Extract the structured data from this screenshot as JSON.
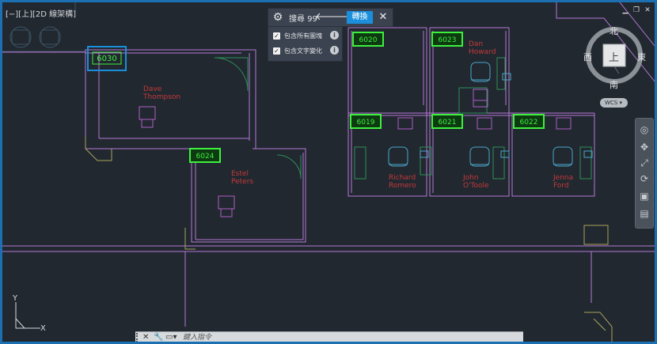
{
  "viewport": {
    "label": "[−][上][2D 線架構]"
  },
  "find_toolbar": {
    "label": "搜尋 99",
    "prev_icon": "arrow-left-icon",
    "next_icon": "arrow-right-icon",
    "replace_label": "轉換",
    "options": [
      {
        "label": "包含所有圖塊",
        "checked": true
      },
      {
        "label": "包含文字變化",
        "checked": true
      }
    ]
  },
  "viewcube": {
    "north": "北",
    "south": "南",
    "west": "西",
    "east": "東",
    "face": "上",
    "wcs": "WCS"
  },
  "drawing": {
    "rooms": [
      {
        "number": "6030",
        "selected": true
      },
      {
        "number": "6024",
        "selected": false
      },
      {
        "number": "6020",
        "selected": false
      },
      {
        "number": "6023",
        "selected": false
      },
      {
        "number": "6019",
        "selected": false
      },
      {
        "number": "6021",
        "selected": false
      },
      {
        "number": "6022",
        "selected": false
      }
    ],
    "people": [
      {
        "first": "Dave",
        "last": "Thompson"
      },
      {
        "first": "Estel",
        "last": "Peters"
      },
      {
        "first": "Dan",
        "last": "Howard"
      },
      {
        "first": "Richard",
        "last": "Romero"
      },
      {
        "first": "John",
        "last": "O'Toole"
      },
      {
        "first": "Jenna",
        "last": "Ford"
      }
    ],
    "ucs_x": "X",
    "ucs_y": "Y"
  },
  "command_line": {
    "placeholder": "鍵入指令"
  },
  "colors": {
    "frame": "#1c6fb0",
    "canvas": "#212830",
    "wall": "#b678d6",
    "text_red": "#c43a3a",
    "tag_green": "#3df03d",
    "accent": "#1b8fdc"
  }
}
